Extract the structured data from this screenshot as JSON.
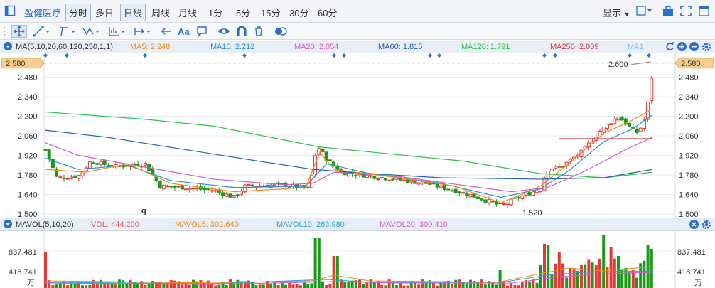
{
  "app": {
    "name": "盈健医疗",
    "periods": [
      "分时",
      "多日",
      "日线",
      "周线",
      "月线",
      "1分",
      "5分",
      "15分",
      "30分",
      "60分"
    ],
    "selected_period": "日线",
    "active_period": "分时",
    "display_label": "显示"
  },
  "toolbar": {
    "tools": [
      "move-tool",
      "line-tool",
      "channel-tool",
      "wave-tool",
      "fib-tool",
      "range-tool",
      "arrow-tool",
      "text-tool",
      "note-tool",
      "eye-tool",
      "magnet-tool",
      "trash-tool",
      "layer-tool"
    ],
    "text_tool_label": "Aa"
  },
  "ma_panel": {
    "header": "MA(5,10,20,60,120,250,1,1)",
    "items": [
      {
        "label": "MA5: 2.248",
        "color": "#f08a1c"
      },
      {
        "label": "MA10: 2.212",
        "color": "#2a8fd6"
      },
      {
        "label": "MA20: 2.054",
        "color": "#d35fc8"
      },
      {
        "label": "MA60: 1.815",
        "color": "#1f5fb3"
      },
      {
        "label": "MA120: 1.791",
        "color": "#2bc24a"
      },
      {
        "label": "MA250: 2.039",
        "color": "#d8343b"
      },
      {
        "label": "MA1",
        "color": "#7fc6ee"
      }
    ]
  },
  "vol_panel": {
    "header": "MAVOL(5,10,20)",
    "items": [
      {
        "label": "VOL: 444.200",
        "color": "#e25d5d"
      },
      {
        "label": "MAVOL5: 302.640",
        "color": "#f08a1c"
      },
      {
        "label": "MAVOL10: 263.980",
        "color": "#2aa6c9"
      },
      {
        "label": "MAVOL20: 300.410",
        "color": "#d35fc8"
      }
    ],
    "axis_labels": [
      "837.481",
      "418.741"
    ],
    "unit": "万"
  },
  "price_axis": {
    "labels": [
      "2.480",
      "2.340",
      "2.200",
      "2.060",
      "1.920",
      "1.780",
      "1.640",
      "1.500"
    ],
    "current_price": "2.580",
    "annotation_high": "2.600",
    "annotation_low": "1.520",
    "marker_q": "q"
  },
  "colors": {
    "up": "#e53935",
    "down": "#1a9a1a",
    "price_tag": "#f7ce8f",
    "header_bg": "#e9eef6"
  }
}
